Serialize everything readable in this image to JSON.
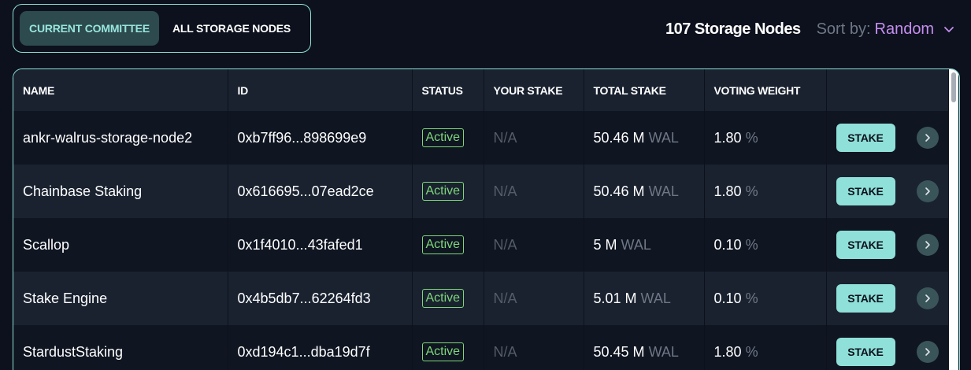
{
  "tabs": [
    {
      "label": "CURRENT COMMITTEE",
      "active": true
    },
    {
      "label": "ALL STORAGE NODES",
      "active": false
    }
  ],
  "header": {
    "node_count": "107 Storage Nodes",
    "sort_label": "Sort by:",
    "sort_value": "Random",
    "sort_icon": "chevron-down-icon"
  },
  "table": {
    "columns": [
      "NAME",
      "ID",
      "STATUS",
      "YOUR STAKE",
      "TOTAL STAKE",
      "VOTING WEIGHT",
      ""
    ],
    "rows": [
      {
        "name": "ankr-walrus-storage-node2",
        "id": "0xb7ff96...898699e9",
        "status": "Active",
        "your_stake": "N/A",
        "total_value": "50.46 M",
        "total_unit": "WAL",
        "weight_value": "1.80",
        "weight_unit": "%",
        "action": "STAKE"
      },
      {
        "name": "Chainbase Staking",
        "id": "0x616695...07ead2ce",
        "status": "Active",
        "your_stake": "N/A",
        "total_value": "50.46 M",
        "total_unit": "WAL",
        "weight_value": "1.80",
        "weight_unit": "%",
        "action": "STAKE"
      },
      {
        "name": "Scallop",
        "id": "0x1f4010...43fafed1",
        "status": "Active",
        "your_stake": "N/A",
        "total_value": "5 M",
        "total_unit": "WAL",
        "weight_value": "0.10",
        "weight_unit": "%",
        "action": "STAKE"
      },
      {
        "name": "Stake Engine",
        "id": "0x4b5db7...62264fd3",
        "status": "Active",
        "your_stake": "N/A",
        "total_value": "5.01 M",
        "total_unit": "WAL",
        "weight_value": "0.10",
        "weight_unit": "%",
        "action": "STAKE"
      },
      {
        "name": "StardustStaking",
        "id": "0xd194c1...dba19d7f",
        "status": "Active",
        "your_stake": "N/A",
        "total_value": "50.45 M",
        "total_unit": "WAL",
        "weight_value": "1.80",
        "weight_unit": "%",
        "action": "STAKE"
      }
    ]
  },
  "colors": {
    "accent": "#8fe0d8",
    "sort_value": "#c68ef0",
    "status_active": "#7fd67a",
    "background": "#0c111d"
  },
  "icons": {
    "row_arrow": "chevron-right-icon"
  }
}
